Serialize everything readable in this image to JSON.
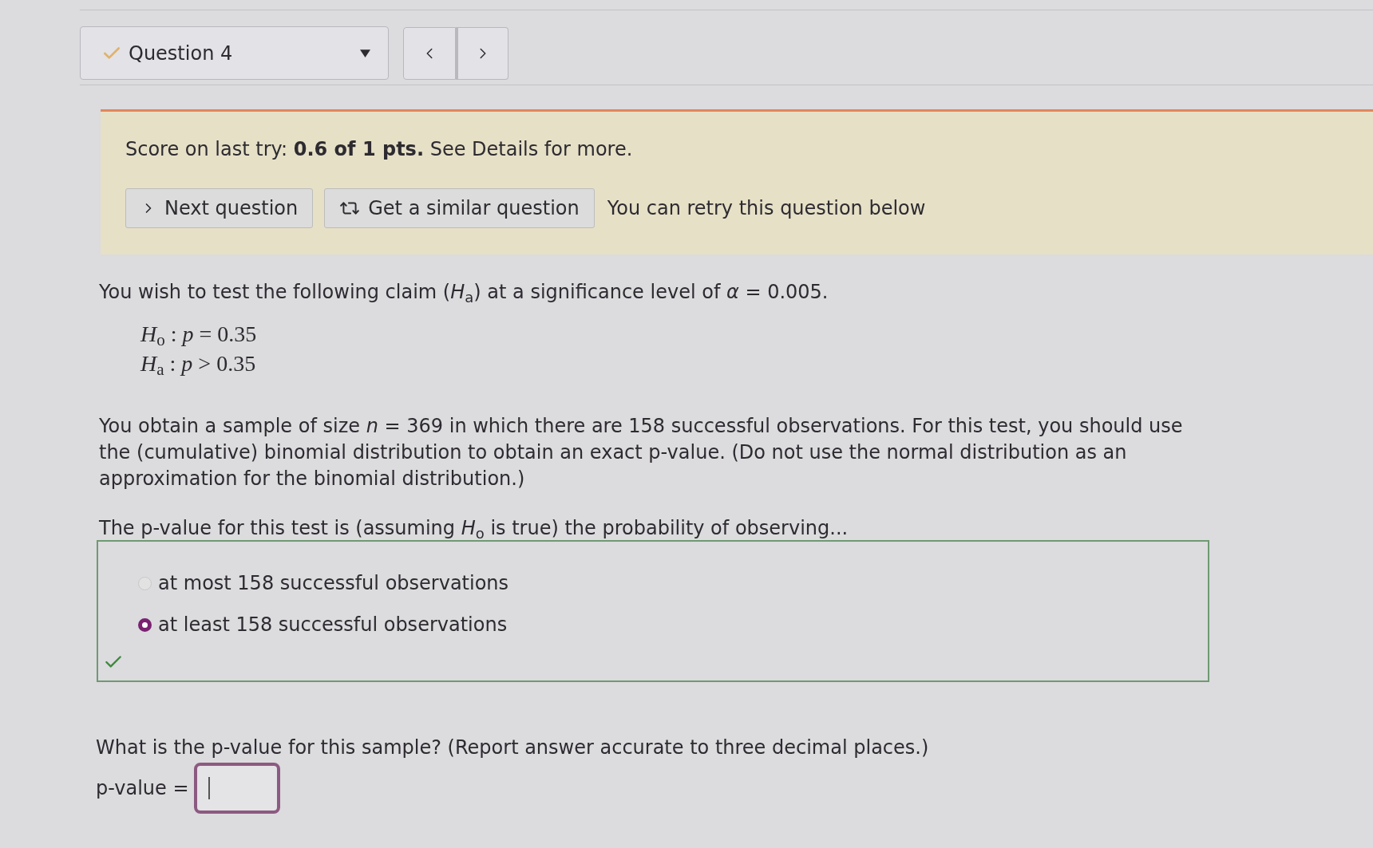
{
  "question_nav": {
    "title": "Question 4",
    "completed": true
  },
  "score_banner": {
    "text": "Score on last try: **0.6 of 1 pts.** See Details for more.",
    "buttons": [
      {
        "kind": "next",
        "label": "Next question"
      },
      {
        "kind": "similar",
        "label": "Get a similar question"
      }
    ],
    "note": "You can retry this question below"
  },
  "question": {
    "intro": "You wish to test the following claim (*H*$_{a}$) at a significance level of *α* = 0.005.",
    "hypotheses": [
      "*H*$_{o}$ : *p* = 0.35",
      "*H*$_{a}$ : *p* > 0.35"
    ],
    "paragraph": "You obtain a sample of size *n* = 369 in which there are 158 successful observations. For this test, you should use the (cumulative) binomial distribution to obtain an exact p-value. (Do not use the normal distribution as an approximation for the binomial distribution.)",
    "prompt": "The p-value for this test is (assuming *H*$_{o}$ is true) the probability of observing...",
    "options": [
      {
        "label": "at most 158 successful observations",
        "selected": false
      },
      {
        "label": "at least 158 successful observations",
        "selected": true
      }
    ],
    "correct": true,
    "second_prompt": "What is the p-value for this sample? (Report answer accurate to three decimal places.)",
    "answer": {
      "label": "p-value =",
      "focused": true
    }
  }
}
